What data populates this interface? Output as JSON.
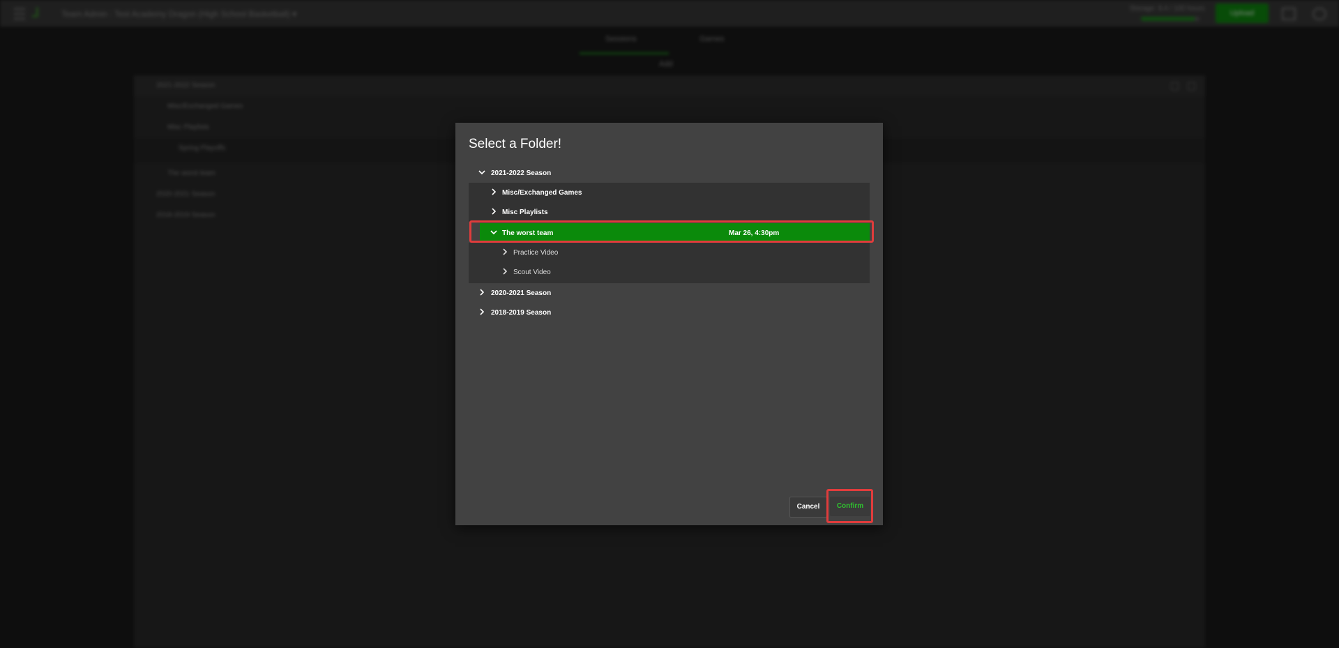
{
  "background": {
    "app_title": "Team Admin : Test Academy Dragon (High School Basketball) ▾",
    "storage_text": "Storage: 8.4 / 100 hours",
    "storage_fraction": 0.92,
    "upload_label": "Upload",
    "tabs": [
      "Sessions",
      "Games"
    ],
    "add_label": "Add",
    "rows": [
      {
        "label": "2021-2022 Season"
      },
      {
        "label": "Misc/Exchanged Games"
      },
      {
        "label": "Misc Playlists"
      },
      {
        "label": "Spring Playoffs"
      },
      {
        "label": "The worst team"
      },
      {
        "label": "2020-2021 Season"
      },
      {
        "label": "2018-2019 Season"
      }
    ],
    "accent_color": "#0b8a0b"
  },
  "modal": {
    "title": "Select a Folder!",
    "tree": [
      {
        "label": "2021-2022 Season",
        "expanded": true
      },
      {
        "label": "Misc/Exchanged Games",
        "expanded": false
      },
      {
        "label": "Misc Playlists",
        "expanded": false
      },
      {
        "label": "The worst team",
        "expanded": true,
        "selected": true,
        "date": "Mar 26, 4:30pm"
      },
      {
        "label": "Practice Video",
        "expanded": false
      },
      {
        "label": "Scout Video",
        "expanded": false
      },
      {
        "label": "2020-2021 Season",
        "expanded": false
      },
      {
        "label": "2018-2019 Season",
        "expanded": false
      }
    ],
    "cancel_label": "Cancel",
    "confirm_label": "Confirm",
    "selected_color": "#0b8a0b",
    "confirm_color": "#2fc12f",
    "highlight_color": "#e03c3c"
  }
}
